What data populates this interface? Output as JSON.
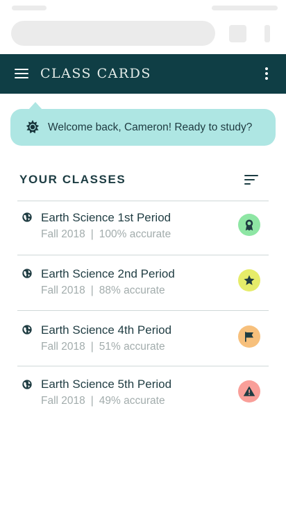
{
  "app_bar": {
    "title": "CLASS CARDS"
  },
  "banner": {
    "message": "Welcome back, Cameron! Ready to study?",
    "icon": "gear-sun-icon"
  },
  "classes_section": {
    "title": "YOUR CLASSES"
  },
  "classes": [
    {
      "name": "Earth Science 1st Period",
      "term": "Fall 2018",
      "separator": "|",
      "accuracy": "100% accurate",
      "badge_icon": "award-icon",
      "badge_color": "#8ee6a4"
    },
    {
      "name": "Earth Science 2nd Period",
      "term": "Fall 2018",
      "separator": "|",
      "accuracy": "88% accurate",
      "badge_icon": "star-icon",
      "badge_color": "#e6ec6a"
    },
    {
      "name": "Earth Science 4th Period",
      "term": "Fall 2018",
      "separator": "|",
      "accuracy": "51% accurate",
      "badge_icon": "flag-icon",
      "badge_color": "#f7c07c"
    },
    {
      "name": "Earth Science 5th Period",
      "term": "Fall 2018",
      "separator": "|",
      "accuracy": "49% accurate",
      "badge_icon": "warning-icon",
      "badge_color": "#f99f99"
    }
  ],
  "colors": {
    "app_bar": "#0f3e45",
    "banner": "#aee6e3",
    "primary_text": "#1f3c42",
    "secondary_text": "#a2acac"
  }
}
